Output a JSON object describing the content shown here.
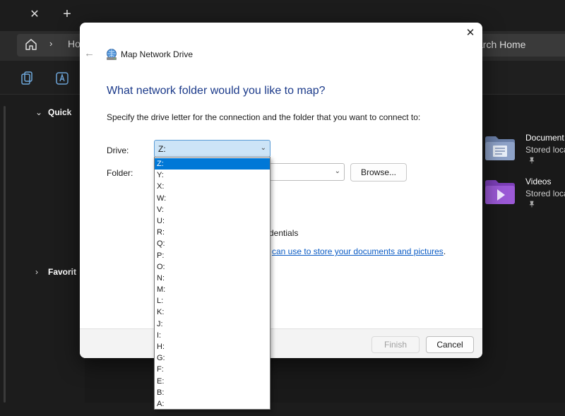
{
  "explorer": {
    "tab_close": "✕",
    "tab_new": "+",
    "address_chevron": "›",
    "address_text": "Ho",
    "search_placeholder": "arch Home",
    "nav": {
      "quick_access": "Quick",
      "favorites": "Favorit"
    },
    "quick_items": [
      {
        "name": "Document",
        "sub": "Stored loca",
        "icon": "documents-folder-icon"
      },
      {
        "name": "Videos",
        "sub": "Stored loca",
        "icon": "videos-folder-icon"
      }
    ],
    "pin_glyph": "📌"
  },
  "dialog": {
    "title": "Map Network Drive",
    "close_glyph": "✕",
    "back_glyph": "←",
    "heading": "What network folder would you like to map?",
    "description": "Specify the drive letter for the connection and the folder that you want to connect to:",
    "drive_label": "Drive:",
    "folder_label": "Folder:",
    "drive_value": "Z:",
    "browse_label": "Browse...",
    "credentials_text": "dentials",
    "link_text": "can use to store your documents and pictures",
    "link_suffix": ".",
    "finish_label": "Finish",
    "cancel_label": "Cancel"
  },
  "drive_options": [
    "Z:",
    "Y:",
    "X:",
    "W:",
    "V:",
    "U:",
    "R:",
    "Q:",
    "P:",
    "O:",
    "N:",
    "M:",
    "L:",
    "K:",
    "J:",
    "I:",
    "H:",
    "G:",
    "F:",
    "E:",
    "B:",
    "A:"
  ],
  "selected_drive": "Z:",
  "colors": {
    "accent": "#0078d7",
    "heading": "#1b3a8a",
    "link": "#0a5bc4"
  }
}
